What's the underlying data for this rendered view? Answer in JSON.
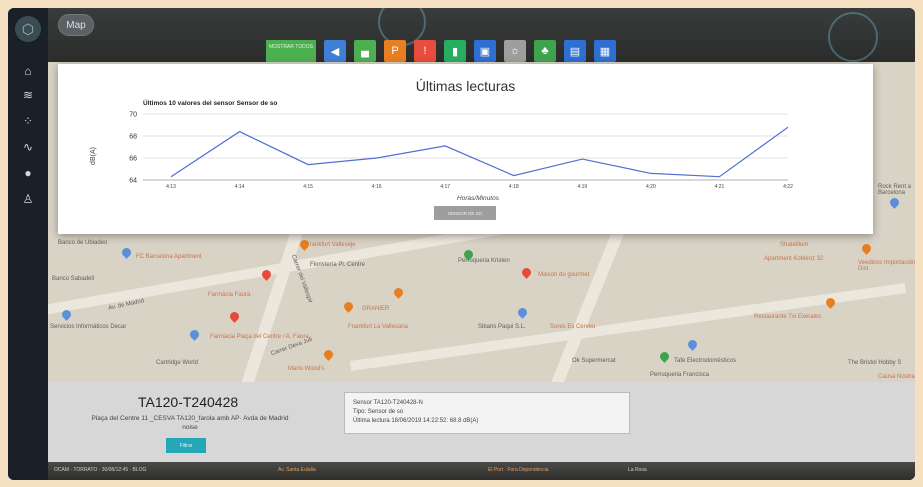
{
  "header": {
    "map_button": "Map",
    "active_tab": "MOSTRAR TODOS"
  },
  "toolbar": {
    "icons": [
      {
        "name": "noise-icon",
        "color": "#3f7fd6",
        "glyph": "◀"
      },
      {
        "name": "car-icon",
        "color": "#4caf50",
        "glyph": "▄"
      },
      {
        "name": "parking-icon",
        "color": "#e67e22",
        "glyph": "P"
      },
      {
        "name": "alert-icon",
        "color": "#e74c3c",
        "glyph": "!"
      },
      {
        "name": "waste-icon",
        "color": "#27ae60",
        "glyph": "▮"
      },
      {
        "name": "device-icon",
        "color": "#2f6fd1",
        "glyph": "▣"
      },
      {
        "name": "light-icon",
        "color": "#9e9e9e",
        "glyph": "☼"
      },
      {
        "name": "tree-icon",
        "color": "#3fa34d",
        "glyph": "♣"
      },
      {
        "name": "screen-icon",
        "color": "#2f6fd1",
        "glyph": "▤"
      },
      {
        "name": "calendar-icon",
        "color": "#2f6fd1",
        "glyph": "▦"
      }
    ]
  },
  "modal": {
    "title": "Últimas lecturas",
    "button_label": "SENSOR DE SO"
  },
  "chart_data": {
    "type": "line",
    "title": "Últimos 10 valores del sensor Sensor de so",
    "xlabel": "Horas/Minutos",
    "ylabel": "dB(A)",
    "categories": [
      "4:13",
      "4:14",
      "4:15",
      "4:16",
      "4:17",
      "4:18",
      "4:19",
      "4:20",
      "4:21",
      "4:22"
    ],
    "values": [
      64.3,
      68.4,
      65.4,
      66.0,
      67.1,
      64.4,
      65.9,
      64.6,
      64.3,
      68.8
    ],
    "ylim": [
      64,
      70
    ],
    "yticks": [
      64,
      66,
      68,
      70
    ],
    "grid": true,
    "line_color": "#4f6fd1"
  },
  "map": {
    "labels": [
      {
        "text": "FC Barcelona Apartment",
        "orange": true
      },
      {
        "text": "Frankfurt Valleseje",
        "orange": true
      },
      {
        "text": "Floristería Pl. Centre",
        "orange": false
      },
      {
        "text": "Perruqueria Kristen",
        "orange": false
      },
      {
        "text": "Maison du gourmet",
        "orange": true
      },
      {
        "text": "Banco Sabadell",
        "orange": false
      },
      {
        "text": "Av. de Madrid",
        "orange": false
      },
      {
        "text": "Farmàcia Faura",
        "orange": true
      },
      {
        "text": "Carrer del Vallespir",
        "orange": false
      },
      {
        "text": "GRANIER",
        "orange": true
      },
      {
        "text": "Frankfurt La Vallesana",
        "orange": true
      },
      {
        "text": "Sibaris Paqui S.L.",
        "orange": false
      },
      {
        "text": "Sores Es Cerveu",
        "orange": true
      },
      {
        "text": "Servicios Informáticos Decar",
        "orange": false
      },
      {
        "text": "Farmàcia Plaça del Centre / A. Faura",
        "orange": true
      },
      {
        "text": "Carrer Deva Juli",
        "orange": false
      },
      {
        "text": "Cartridge World",
        "orange": false
      },
      {
        "text": "Marlo Wood's",
        "orange": true
      },
      {
        "text": "Ok Supermercat",
        "orange": false
      },
      {
        "text": "Tafe Electrodomésticos",
        "orange": false
      },
      {
        "text": "Perruqueria Francisca",
        "orange": false
      },
      {
        "text": "Restaurante Txi Exerales",
        "orange": true
      },
      {
        "text": "Apartment Koblenz 32",
        "orange": true
      },
      {
        "text": "Stratellium",
        "orange": true
      },
      {
        "text": "Veedicos Importación Y Dist",
        "orange": true
      },
      {
        "text": "The Bristol Hobby S",
        "orange": false
      },
      {
        "text": "Causa Nostra",
        "orange": true
      },
      {
        "text": "Rock Rent a Barcelona",
        "orange": false
      },
      {
        "text": "Banco de Ubiadeo",
        "orange": false
      }
    ]
  },
  "info": {
    "sensor_name": "TA120-T240428",
    "address_line1": "Plaça del Centre 11 _CESVA TA120_farola amb AP· Avda de Madrid",
    "address_line2": "noise",
    "address_button": "Filtrar",
    "card_line1": "Sensor TA120-T240428-N",
    "card_line2": "Tipo: Sensor de so",
    "card_line3": "Última lectura 18/06/2019 14:22:52: 68.8 dB(A)"
  },
  "footer": {
    "left": "OCAM  ·  TORRATO  ·  30/08/12:45  ·  BLOG",
    "mid1": "Av. Santa Eulalia",
    "mid2": "El Port · Fora Dependència",
    "mid3": "La Rosa"
  }
}
